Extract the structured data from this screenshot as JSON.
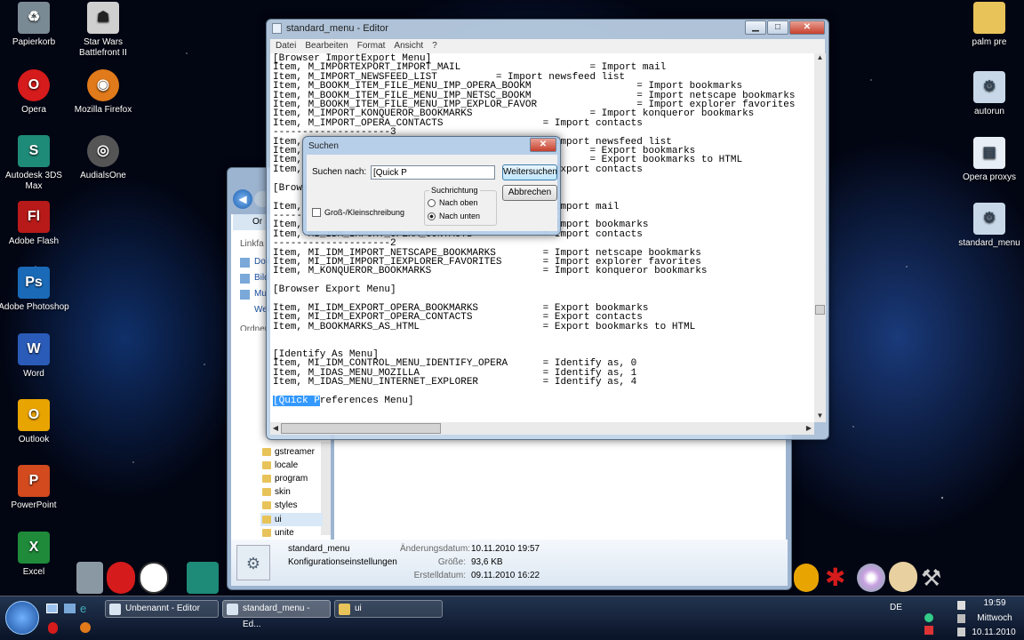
{
  "desktop_icons": [
    {
      "label": "Papierkorb",
      "icon": "recycle-bin-icon",
      "color": "#7a8a95"
    },
    {
      "label": "Star Wars Battlefront II",
      "icon": "stormtrooper-icon",
      "color": "#cfcfcf"
    },
    {
      "label": "Opera",
      "icon": "opera-icon",
      "color": "#d51b1b"
    },
    {
      "label": "Mozilla Firefox",
      "icon": "firefox-icon",
      "color": "#e07a1a"
    },
    {
      "label": "Autodesk 3DS Max",
      "icon": "3dsmax-icon",
      "color": "#1e8a78"
    },
    {
      "label": "AudialsOne",
      "icon": "audials-icon",
      "color": "#555"
    },
    {
      "label": "Adobe Flash",
      "icon": "flash-icon",
      "color": "#b81a1a"
    },
    {
      "label": "Adobe Photoshop",
      "icon": "photoshop-icon",
      "color": "#1a6ab8"
    },
    {
      "label": "Word",
      "icon": "word-icon",
      "color": "#2a5bb8"
    },
    {
      "label": "Outlook",
      "icon": "outlook-icon",
      "color": "#e8a400"
    },
    {
      "label": "PowerPoint",
      "icon": "powerpoint-icon",
      "color": "#d24a1e"
    },
    {
      "label": "Excel",
      "icon": "excel-icon",
      "color": "#1e8a3a"
    },
    {
      "label": "palm pre",
      "icon": "folder-icon",
      "color": "#e8c35a"
    },
    {
      "label": "autorun",
      "icon": "settings-file-icon",
      "color": "#c8d8e8"
    },
    {
      "label": "Opera proxys",
      "icon": "file-icon",
      "color": "#e8eef5"
    },
    {
      "label": "standard_menu",
      "icon": "settings-file-icon",
      "color": "#c8d8e8"
    }
  ],
  "editor": {
    "title": "standard_menu - Editor",
    "menu": [
      "Datei",
      "Bearbeiten",
      "Format",
      "Ansicht",
      "?"
    ],
    "lines": [
      "[Browser ImportExport Menu]",
      "Item, M_IMPORTEXPORT_IMPORT_MAIL                      = Import mail",
      "Item, M_IMPORT_NEWSFEED_LIST          = Import newsfeed list",
      "Item, M_BOOKM_ITEM_FILE_MENU_IMP_OPERA_BOOKM                  = Import bookmarks",
      "Item, M_BOOKM_ITEM_FILE_MENU_IMP_NETSC_BOOKM                  = Import netscape bookmarks",
      "Item, M_BOOKM_ITEM_FILE_MENU_IMP_EXPLOR_FAVOR                 = Import explorer favorites",
      "Item, M_IMPORT_KONQUEROR_BOOKMARKS                    = Import konqueror bookmarks",
      "Item, M_IMPORT_OPERA_CONTACTS                 = Import contacts",
      "--------------------3",
      "Item,                                         = Import newsfeed list",
      "Item,                                                 = Export bookmarks",
      "Item,                                                 = Export bookmarks to HTML",
      "Item,                                         = Export contacts",
      "",
      "[Brows",
      "",
      "Item,                                         = Import mail",
      "-----",
      "Item,                                         = Import bookmarks",
      "Item, MI_IDM_IMPORT_OPERA_CONTACTS            = Import contacts",
      "--------------------2",
      "Item, MI_IDM_IMPORT_NETSCAPE_BOOKMARKS        = Import netscape bookmarks",
      "Item, MI_IDM_IMPORT_IEXPLORER_FAVORITES       = Import explorer favorites",
      "Item, M_KONQUEROR_BOOKMARKS                   = Import konqueror bookmarks",
      "",
      "[Browser Export Menu]",
      "",
      "Item, MI_IDM_EXPORT_OPERA_BOOKMARKS           = Export bookmarks",
      "Item, MI_IDM_EXPORT_OPERA_CONTACTS            = Export contacts",
      "Item, M_BOOKMARKS_AS_HTML                     = Export bookmarks to HTML",
      "",
      "",
      "[Identify As Menu]",
      "Item, MI_IDM_CONTROL_MENU_IDENTIFY_OPERA      = Identify as, 0",
      "Item, M_IDAS_MENU_MOZILLA                     = Identify as, 1",
      "Item, M_IDAS_MENU_INTERNET_EXPLORER           = Identify as, 4",
      ""
    ],
    "highlight": "[Quick P",
    "highlight_rest": "references Menu]"
  },
  "find_dialog": {
    "title": "Suchen",
    "label": "Suchen nach:",
    "value": "[Quick P",
    "find_next": "Weitersuchen",
    "cancel": "Abbrechen",
    "direction_label": "Suchrichtung",
    "up": "Nach oben",
    "down": "Nach unten",
    "match_case": "Groß-/Kleinschreibung"
  },
  "explorer": {
    "nav_partial": [
      "Or",
      "Linkfa",
      "Dok",
      "Bild",
      "Mu",
      "Wei",
      "Ordner"
    ],
    "folders": [
      "gstreamer",
      "locale",
      "program",
      "skin",
      "styles",
      "ui",
      "unite"
    ],
    "details": {
      "name": "standard_menu",
      "type": "Konfigurationseinstellungen",
      "modified_label": "Änderungsdatum:",
      "modified": "10.11.2010 19:57",
      "size_label": "Größe:",
      "size": "93,6 KB",
      "created_label": "Erstelldatum:",
      "created": "09.11.2010 16:22"
    }
  },
  "taskbar": {
    "items": [
      "Unbenannt - Editor",
      "standard_menu - Ed...",
      "ui"
    ],
    "lang": "DE",
    "time": "19:59",
    "day": "Mittwoch",
    "date": "10.11.2010"
  }
}
